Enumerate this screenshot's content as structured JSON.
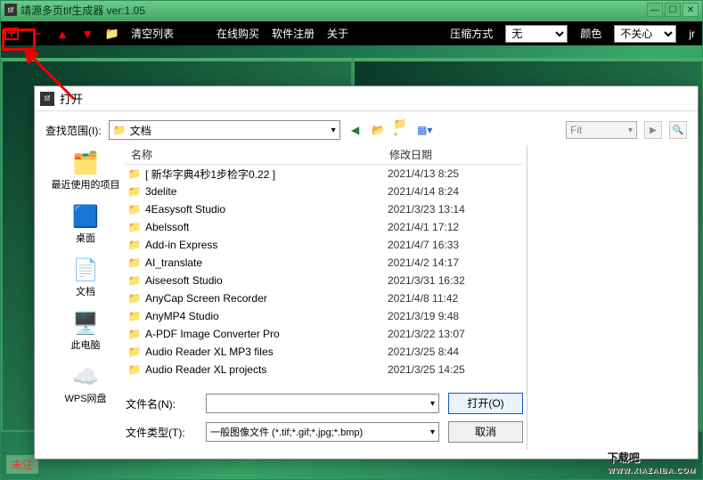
{
  "main": {
    "title": "靖源多页tif生成器 ver:1.05",
    "toolbar": {
      "clear": "清空列表",
      "buy": "在线购买",
      "register": "软件注册",
      "about": "关于",
      "compress_label": "压缩方式",
      "compress_value": "无",
      "color_label": "颜色",
      "color_value": "不关心",
      "extra": "jr"
    },
    "status": "未注"
  },
  "dialog": {
    "title": "打开",
    "lookin_label": "查找范围(I):",
    "lookin_value": "文档",
    "fit": "Fit",
    "columns": {
      "name": "名称",
      "date": "修改日期"
    },
    "places": [
      {
        "label": "最近使用的项目",
        "icon": "recent"
      },
      {
        "label": "桌面",
        "icon": "desktop"
      },
      {
        "label": "文档",
        "icon": "documents"
      },
      {
        "label": "此电脑",
        "icon": "pc"
      },
      {
        "label": "WPS网盘",
        "icon": "wps"
      }
    ],
    "files": [
      {
        "name": "[ 新华字典4秒1步检字0.22 ]",
        "date": "2021/4/13 8:25"
      },
      {
        "name": "3delite",
        "date": "2021/4/14 8:24"
      },
      {
        "name": "4Easysoft Studio",
        "date": "2021/3/23 13:14"
      },
      {
        "name": "Abelssoft",
        "date": "2021/4/1 17:12"
      },
      {
        "name": "Add-in Express",
        "date": "2021/4/7 16:33"
      },
      {
        "name": "AI_translate",
        "date": "2021/4/2 14:17"
      },
      {
        "name": "Aiseesoft Studio",
        "date": "2021/3/31 16:32"
      },
      {
        "name": "AnyCap Screen Recorder",
        "date": "2021/4/8 11:42"
      },
      {
        "name": "AnyMP4 Studio",
        "date": "2021/3/19 9:48"
      },
      {
        "name": "A-PDF Image Converter Pro",
        "date": "2021/3/22 13:07"
      },
      {
        "name": "Audio Reader XL MP3 files",
        "date": "2021/3/25 8:44"
      },
      {
        "name": "Audio Reader XL projects",
        "date": "2021/3/25 14:25"
      }
    ],
    "filename_label": "文件名(N):",
    "filename_value": "",
    "filetype_label": "文件类型(T):",
    "filetype_value": "一般图像文件 (*.tif;*.gif;*.jpg;*.bmp)",
    "open_btn": "打开(O)",
    "cancel_btn": "取消"
  },
  "watermark": {
    "text": "下载吧",
    "sub": "WWW.XIAZAIBA.COM"
  }
}
